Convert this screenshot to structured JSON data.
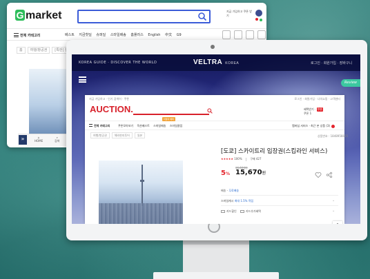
{
  "gmarket": {
    "logo_initial": "G",
    "logo_text": "market",
    "promo_text": "지금 가입하고 쿠폰 받기",
    "category_label": "전체 카테고리",
    "nav_links": [
      "베스트",
      "지금핫딜",
      "슈퍼딜",
      "스마일배송",
      "홈플러스",
      "English",
      "中文",
      "G9"
    ],
    "breadcrumb": [
      "홈",
      "여행/항공권",
      "[특판] 한국"
    ],
    "bottom_home": "HOME",
    "bottom_search": "검색",
    "scroll_glyph": "»"
  },
  "veltra": {
    "left_text": "KOREA GUIDE · DISCOVER THE WORLD",
    "brand": "VELTRA",
    "region": "KOREA",
    "right_text": "로그인 · 회원가입 · 장바구니",
    "review_tag": "Review"
  },
  "auction": {
    "top_left": "지금 가입하고 · 인기 검색어 · 쿠폰",
    "top_right": "로그인 · 회원가입 · 나의쇼핑 · 고객센터",
    "logo": "AUCTION.",
    "promo_line1": "혜택받기 ·",
    "promo_badge": "쿠폰",
    "promo_line2": "쿠폰 1",
    "category": "전체 카테고리",
    "nav_links": [
      "쿠폰모아보기",
      "옥션베스트",
      "스마일배송",
      "스마일클럽"
    ],
    "hot_tag": "이달의 혜택",
    "nav_right": "멤버십 서비스 · 최근 본 상품 (3)",
    "breadcrumb": [
      "여행/항공권",
      "해외현지투어",
      "일본"
    ],
    "crumb_right": "상품번호 : 1848956625",
    "product_title": "[도쿄] 스카이트리 입장권(스킵라인 서비스)",
    "stars": "★★★★★",
    "rating_pct": "100%",
    "reviews": "구매 427",
    "discount_pct": "5",
    "original_price": "16,500원",
    "price": "15,670",
    "price_unit": "원",
    "ship_label": "배송 -",
    "ship_value": "무료배송",
    "smile_label": "스마일캐시",
    "smile_value": "최대 1.5% 적립",
    "card_label": "카드할인",
    "card_label2": "카드추가혜택"
  }
}
